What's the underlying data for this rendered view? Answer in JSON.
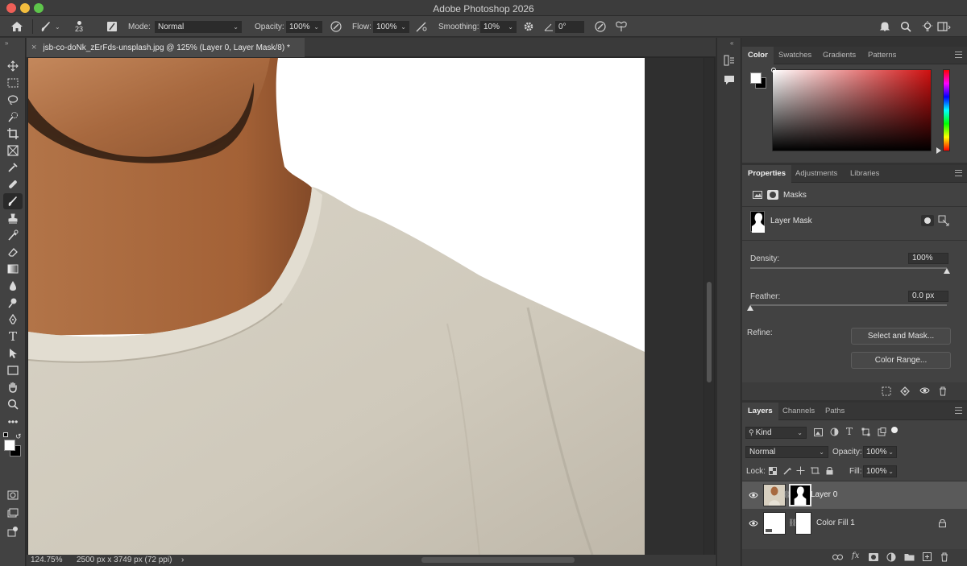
{
  "app": {
    "title": "Adobe Photoshop 2026"
  },
  "options": {
    "brush_size": "23",
    "mode_label": "Mode:",
    "mode_value": "Normal",
    "opacity_label": "Opacity:",
    "opacity_value": "100%",
    "flow_label": "Flow:",
    "flow_value": "100%",
    "smoothing_label": "Smoothing:",
    "smoothing_value": "10%",
    "angle_value": "0°"
  },
  "document": {
    "tab_title": "jsb-co-doNk_zErFds-unsplash.jpg @ 125% (Layer 0, Layer Mask/8) *",
    "close_glyph": "×"
  },
  "status": {
    "zoom": "124.75%",
    "doc_info": "2500 px x 3749 px (72 ppi)",
    "arrow": "›"
  },
  "color_panel": {
    "tabs": [
      "Color",
      "Swatches",
      "Gradients",
      "Patterns"
    ]
  },
  "properties_panel": {
    "tabs": [
      "Properties",
      "Adjustments",
      "Libraries"
    ],
    "section": "Masks",
    "mask_name": "Layer Mask",
    "density_label": "Density:",
    "density_value": "100%",
    "density_level": 1.0,
    "feather_label": "Feather:",
    "feather_value": "0.0 px",
    "feather_level": 0.0,
    "refine_label": "Refine:",
    "select_mask_label": "Select and Mask...",
    "color_range_label": "Color Range..."
  },
  "layers_panel": {
    "tabs": [
      "Layers",
      "Channels",
      "Paths"
    ],
    "filter_kind": "Kind",
    "blend_mode": "Normal",
    "opacity_label": "Opacity:",
    "opacity_value": "100%",
    "lock_label": "Lock:",
    "fill_label": "Fill:",
    "fill_value": "100%",
    "layers": [
      {
        "name": "Layer 0",
        "selected": true
      },
      {
        "name": "Color Fill 1",
        "selected": false
      }
    ]
  },
  "colors": {
    "panel_bg": "#424242",
    "app_bg": "#323232",
    "hue_top": "#ff0000"
  }
}
